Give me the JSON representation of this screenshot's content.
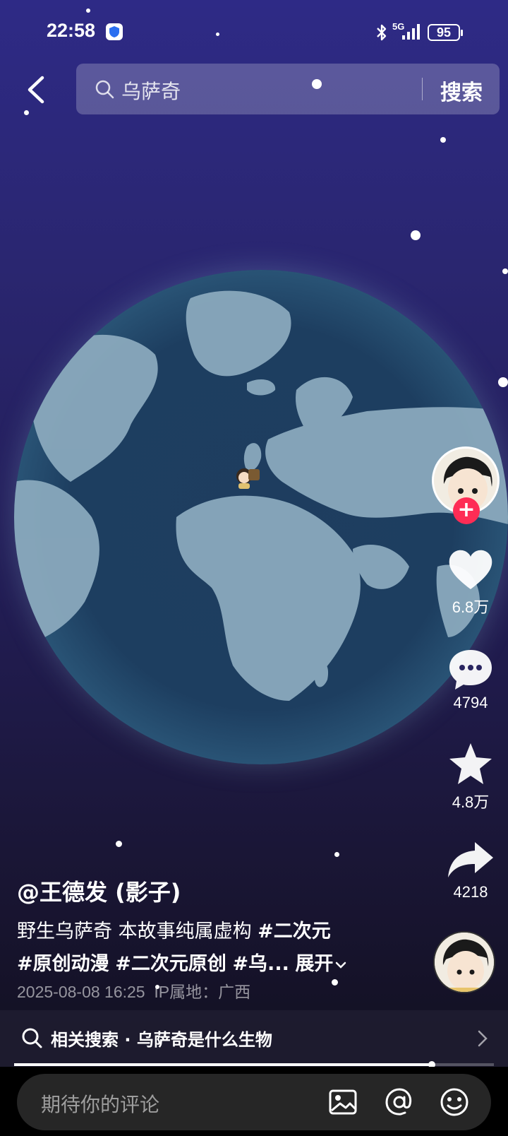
{
  "status_bar": {
    "time": "22:58",
    "network": "5G",
    "battery": "95"
  },
  "search": {
    "query": "乌萨奇",
    "button_label": "搜索"
  },
  "actions": {
    "likes": "6.8万",
    "comments": "4794",
    "favorites": "4.8万",
    "shares": "4218"
  },
  "post": {
    "author": "@王德发 (影子)",
    "description_plain": "野生乌萨奇 本故事纯属虚构 ",
    "tag1": "#二次元",
    "tag2": "#原创动漫",
    "tag3": "#二次元原创",
    "tag4": "#乌...",
    "expand_label": "展开",
    "date": "2025-08-08 16:25",
    "ip_location": "IP属地：广西"
  },
  "related_search": {
    "label": "相关搜索 · 乌萨奇是什么生物"
  },
  "comment_input": {
    "placeholder": "期待你的评论"
  },
  "playback_progress": 0.87,
  "colors": {
    "follow_accent": "#fe2c55",
    "sky_top": "#2e2a86",
    "ocean": "#1d3e60",
    "land": "#8aa9bd"
  }
}
